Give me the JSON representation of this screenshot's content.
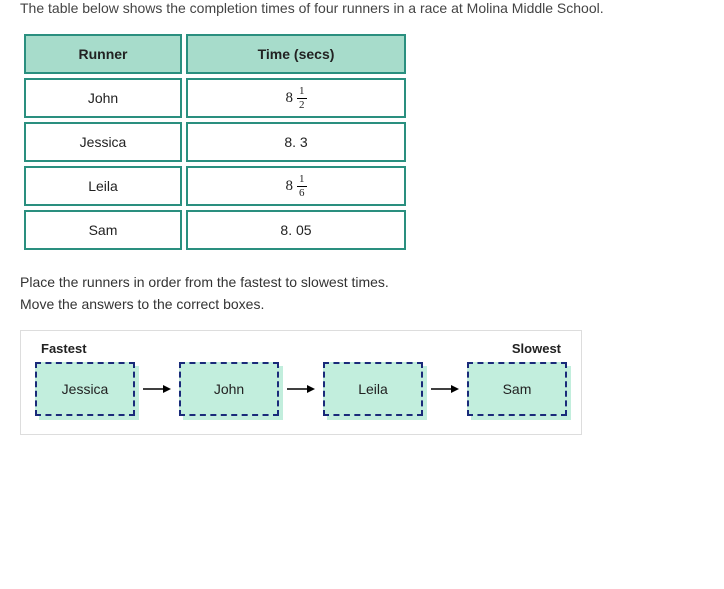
{
  "intro": "The table below shows the completion times of four runners in a race at Molina Middle School.",
  "table": {
    "headers": {
      "runner": "Runner",
      "time": "Time (secs)"
    },
    "rows": [
      {
        "name": "John",
        "time_type": "mixed",
        "whole": "8",
        "num": "1",
        "den": "2",
        "value": 8.5
      },
      {
        "name": "Jessica",
        "time_type": "plain",
        "text": "8. 3",
        "value": 8.3
      },
      {
        "name": "Leila",
        "time_type": "mixed",
        "whole": "8",
        "num": "1",
        "den": "6",
        "value": 8.1667
      },
      {
        "name": "Sam",
        "time_type": "plain",
        "text": "8. 05",
        "value": 8.05
      }
    ]
  },
  "prompt1": "Place the runners in order from the fastest to slowest times.",
  "prompt2": "Move the answers to the correct boxes.",
  "labels": {
    "fastest": "Fastest",
    "slowest": "Slowest"
  },
  "answers": [
    "Jessica",
    "John",
    "Leila",
    "Sam"
  ]
}
